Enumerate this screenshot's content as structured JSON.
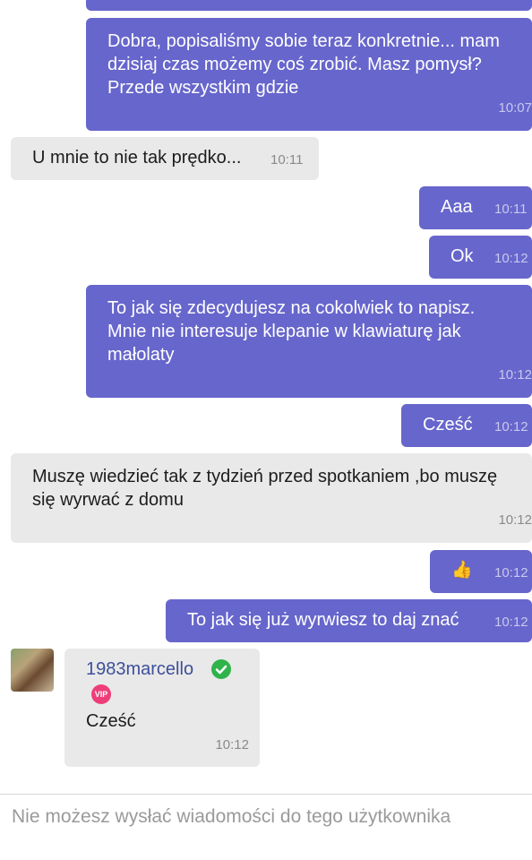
{
  "messages": [
    {
      "id": "m1",
      "dir": "out",
      "text": "Dobra, popisaliśmy sobie teraz konkretnie... mam dzisiaj czas możemy coś zrobić. Masz pomysł? Przede wszystkim gdzie",
      "time": "10:07"
    },
    {
      "id": "m2",
      "dir": "in",
      "text": "U mnie to nie tak prędko...",
      "time": "10:11"
    },
    {
      "id": "m3",
      "dir": "out",
      "text": "Aaa",
      "time": "10:11"
    },
    {
      "id": "m4",
      "dir": "out",
      "text": "Ok",
      "time": "10:12"
    },
    {
      "id": "m5",
      "dir": "out",
      "text": "To jak się zdecydujesz na cokolwiek to napisz. Mnie nie interesuje klepanie w klawiaturę jak małolaty",
      "time": "10:12"
    },
    {
      "id": "m6",
      "dir": "out",
      "text": "Cześć",
      "time": "10:12"
    },
    {
      "id": "m7",
      "dir": "in",
      "text": "Muszę wiedzieć tak z tydzień przed spotkaniem ,bo muszę się wyrwać z domu",
      "time": "10:12"
    },
    {
      "id": "m8",
      "dir": "out",
      "text": "👍",
      "time": "10:12"
    },
    {
      "id": "m9",
      "dir": "out",
      "text": "To jak się już wyrwiesz to daj znać",
      "time": "10:12"
    }
  ],
  "profile_card": {
    "username": "1983marcello",
    "verified_icon": "check-circle-icon",
    "verified_color": "#2fb34a",
    "badge": "VIP",
    "message": "Cześć",
    "time": "10:12"
  },
  "footer": {
    "notice": "Nie możesz wysłać wiadomości do tego użytkownika"
  },
  "colors": {
    "outgoing_bubble": "#6766cc",
    "incoming_bubble": "#e9e9e9",
    "username": "#3d4f9a"
  }
}
